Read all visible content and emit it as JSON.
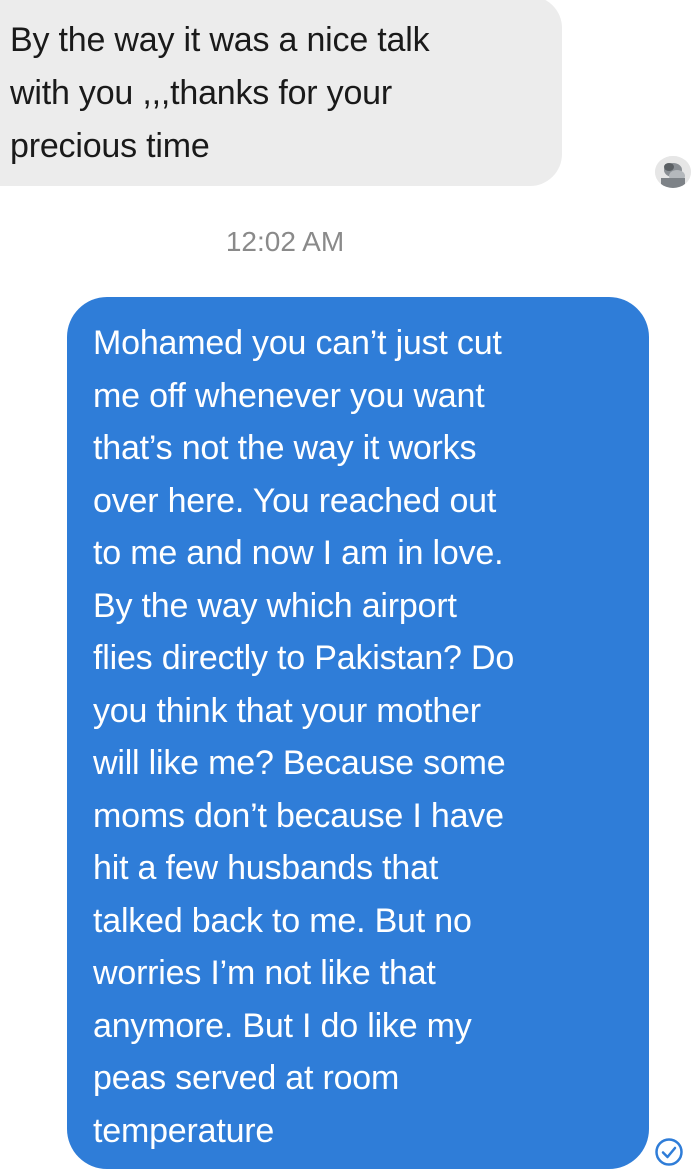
{
  "conversation": {
    "received": {
      "text": "By the way it was a nice talk\nwith you ,,,thanks for your\nprecious time"
    },
    "timestamp": "12:02 AM",
    "sent": {
      "text": "Mohamed you can’t just cut\nme off whenever you want\nthat’s not the way it works\nover here. You reached out\nto me and now I am in love.\nBy the way which airport\nflies directly to Pakistan? Do\nyou think that your mother\nwill like me? Because some\nmoms don’t because I have\nhit a few husbands that\ntalked back to me. But no\nworries I’m not like that\nanymore. But I do like my\npeas served at room\ntemperature"
    }
  },
  "icons": {
    "avatar": "contact-avatar",
    "status": "delivered-check-icon"
  },
  "colors": {
    "sent_bubble": "#2f7dd8",
    "received_bubble": "#ececec",
    "timestamp_text": "#8a8a8a"
  }
}
